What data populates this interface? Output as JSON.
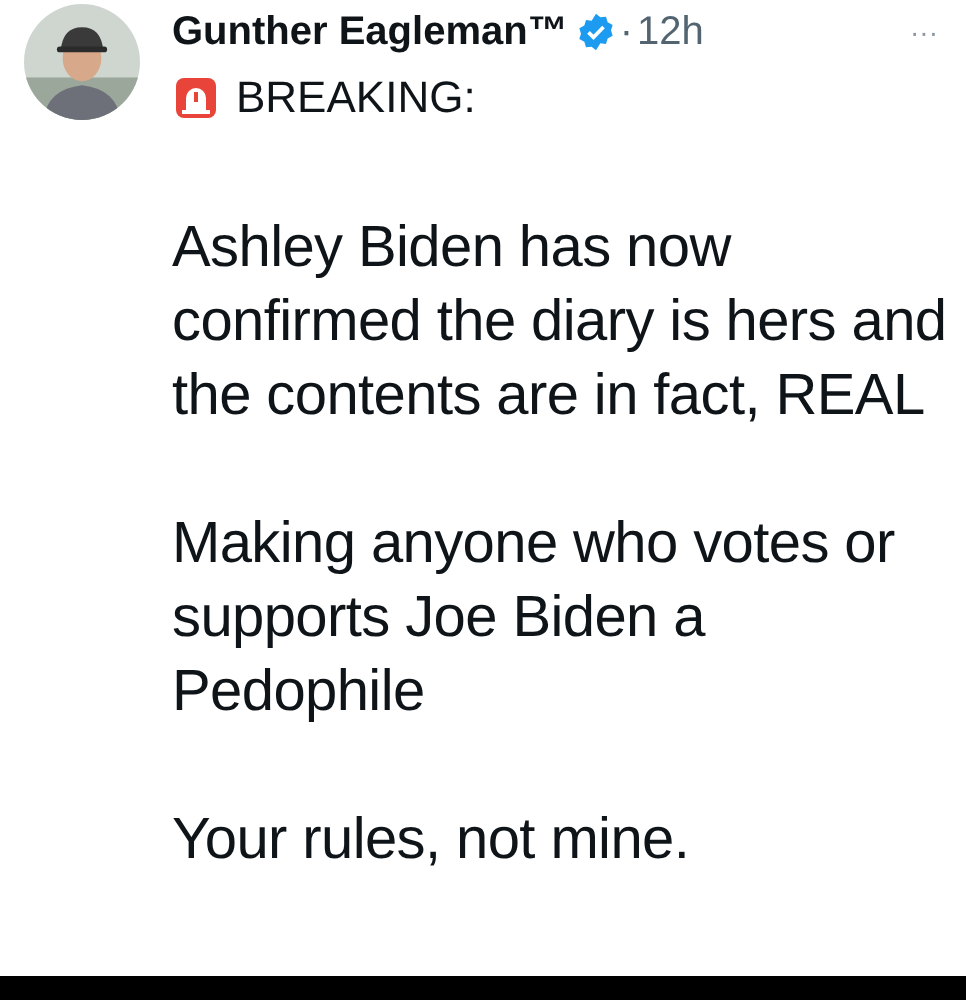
{
  "post": {
    "author": {
      "name": "Gunther Eagleman™",
      "verified": true
    },
    "separator": "·",
    "time": "12h",
    "more": "···",
    "headline": "BREAKING:",
    "paragraphs": [
      "Ashley Biden has now confirmed the diary is hers and the contents are in fact, REAL",
      "Making anyone who votes or supports Joe Biden a Pedophile",
      "Your rules, not mine."
    ]
  }
}
